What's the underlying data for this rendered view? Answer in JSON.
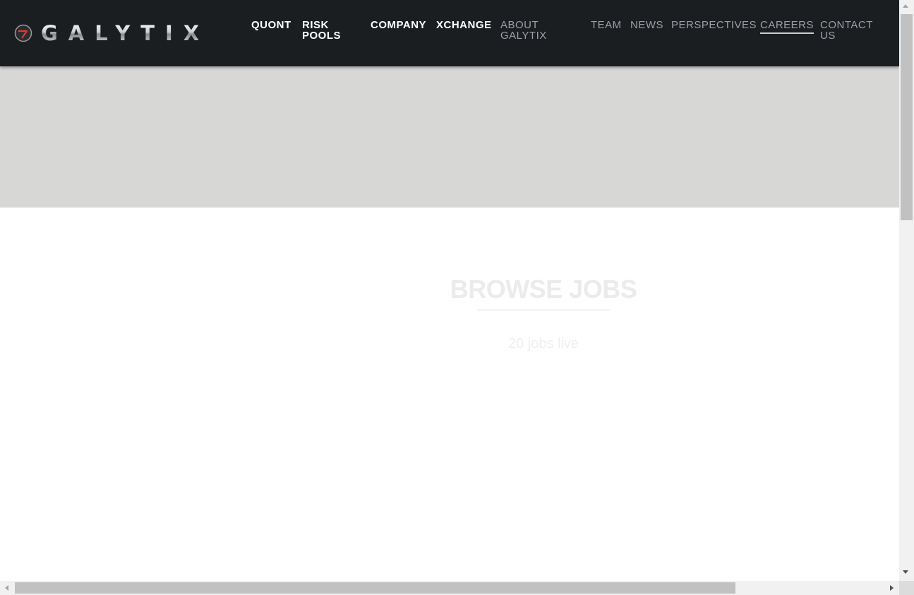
{
  "header": {
    "logo_text": "GALYTIX",
    "nav_primary": [
      {
        "label": "QUONT"
      },
      {
        "label": "RISK POOLS"
      },
      {
        "label": "COMPANY"
      },
      {
        "label": "XCHANGE"
      }
    ],
    "nav_secondary": [
      {
        "label": "ABOUT GALYTIX"
      },
      {
        "label": "TEAM"
      },
      {
        "label": "NEWS"
      },
      {
        "label": "PERSPECTIVES"
      },
      {
        "label": "CAREERS",
        "active": true
      },
      {
        "label": "CONTACT US"
      }
    ]
  },
  "main": {
    "title": "BROWSE JOBS",
    "jobs_count": "20 jobs live"
  },
  "colors": {
    "header_bg": "#1b1e21",
    "hero_bg": "#d7d7d6",
    "logo_accent": "#e03a2f",
    "nav_primary": "#ffffff",
    "nav_secondary": "#9aa0a6"
  },
  "icons": {
    "logo_mark": "galytix-logo-mark-icon"
  }
}
